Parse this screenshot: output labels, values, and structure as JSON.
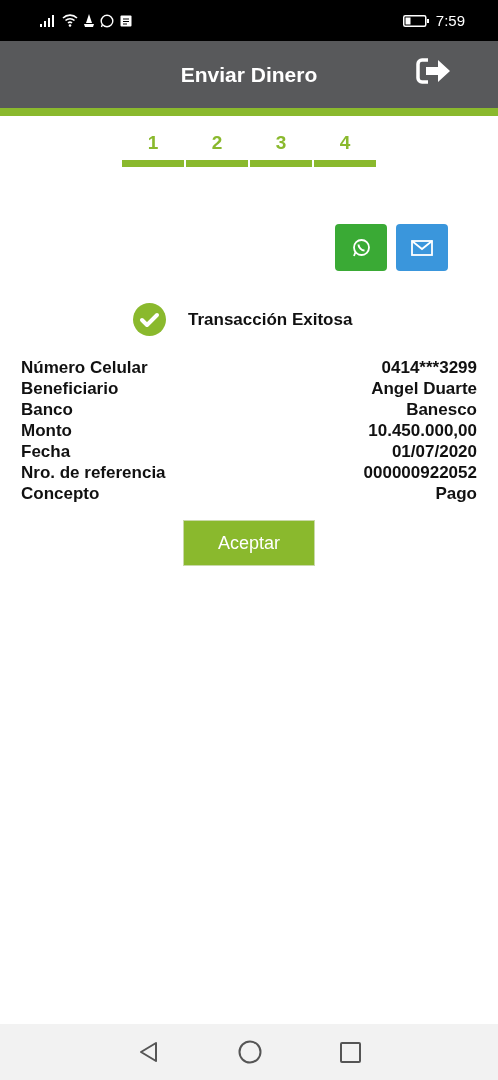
{
  "status_bar": {
    "time": "7:59"
  },
  "header": {
    "title": "Enviar Dinero"
  },
  "steps": [
    {
      "label": "1"
    },
    {
      "label": "2"
    },
    {
      "label": "3"
    },
    {
      "label": "4"
    }
  ],
  "result": {
    "message": "Transacción Exitosa"
  },
  "details": [
    {
      "label": "Número Celular",
      "value": "0414***3299"
    },
    {
      "label": "Beneficiario",
      "value": "Angel Duarte"
    },
    {
      "label": "Banco",
      "value": "Banesco"
    },
    {
      "label": "Monto",
      "value": "10.450.000,00"
    },
    {
      "label": "Fecha",
      "value": "01/07/2020"
    },
    {
      "label": "Nro. de referencia",
      "value": "000000922052"
    },
    {
      "label": "Concepto",
      "value": "Pago"
    }
  ],
  "accept_button": "Aceptar"
}
